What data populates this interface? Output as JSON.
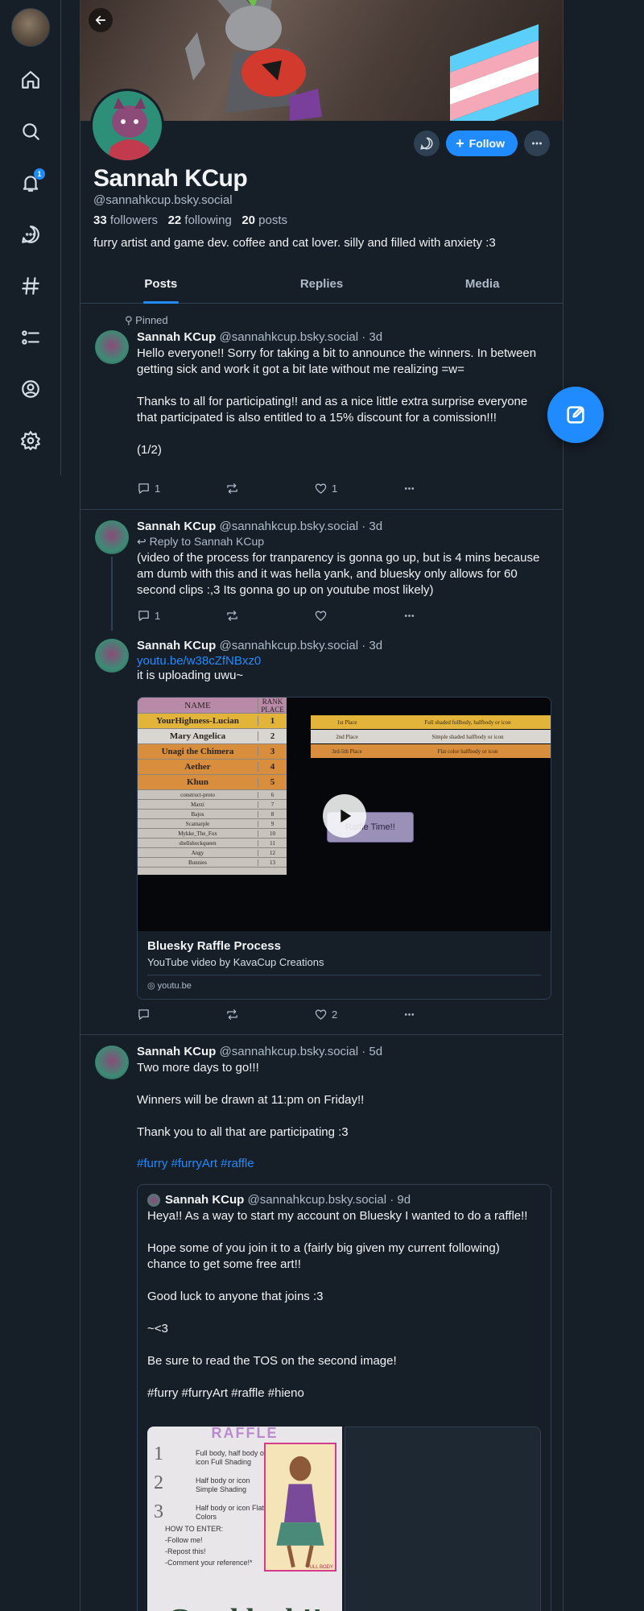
{
  "nav": {
    "notification_count": "1"
  },
  "profile": {
    "display_name": "Sannah KCup",
    "handle": "@sannahkcup.bsky.social",
    "followers_count": "33",
    "followers_label": "followers",
    "following_count": "22",
    "following_label": "following",
    "posts_count": "20",
    "posts_label": "posts",
    "bio": "furry artist and game dev. coffee and cat lover. silly and filled with anxiety :3",
    "follow_label": "Follow"
  },
  "tabs": [
    {
      "label": "Posts"
    },
    {
      "label": "Replies"
    },
    {
      "label": "Media"
    }
  ],
  "posts": [
    {
      "pinned_label": "Pinned",
      "name": "Sannah KCup",
      "handle": "@sannahkcup.bsky.social",
      "time": "· 3d",
      "text": "Hello everyone!! Sorry for taking a bit to announce the winners. In between getting sick and work it got a bit late without me realizing =w=\n\nThanks to all for participating!! and as a nice little extra surprise everyone that participated is also entitled to a 15% discount for a comission!!!\n\n(1/2)",
      "reply_count": "1",
      "repost_count": "",
      "like_count": "1"
    },
    {
      "name": "Sannah KCup",
      "handle": "@sannahkcup.bsky.social",
      "time": "· 3d",
      "reply_to": "Reply to Sannah KCup",
      "text": "(video of the process for tranparency is gonna go up, but is 4 mins because am dumb with this and it was hella yank, and bluesky only allows for 60 second clips :,3 Its gonna go up on youtube most likely)",
      "reply_count": "1",
      "repost_count": "",
      "like_count": ""
    },
    {
      "name": "Sannah KCup",
      "handle": "@sannahkcup.bsky.social",
      "time": "· 3d",
      "link": "youtu.be/w38cZfNBxz0",
      "text": "it is uploading uwu~",
      "embed": {
        "title": "Bluesky Raffle Process",
        "description": "YouTube video by KavaCup Creations",
        "host": "youtu.be",
        "table_header": [
          "NAME",
          "RANK PLACE"
        ],
        "rows": [
          {
            "name": "YourHighness-Lucian",
            "place": "1"
          },
          {
            "name": "Mary Angelica",
            "place": "2"
          },
          {
            "name": "Unagi the Chimera",
            "place": "3"
          },
          {
            "name": "Aether",
            "place": "4"
          },
          {
            "name": "Khun",
            "place": "5"
          },
          {
            "name": "construct-proto",
            "place": "6"
          },
          {
            "name": "Marzi",
            "place": "7"
          },
          {
            "name": "Bajos",
            "place": "8"
          },
          {
            "name": "Scamarple",
            "place": "9"
          },
          {
            "name": "Mykke_The_Fox",
            "place": "10"
          },
          {
            "name": "shellshockqueen",
            "place": "11"
          },
          {
            "name": "Angy",
            "place": "12"
          },
          {
            "name": "Bunnies",
            "place": "13"
          }
        ],
        "prizes": [
          {
            "place": "1st Place",
            "prize": "Full shaded fullbody, halfbody or icon"
          },
          {
            "place": "2nd Place",
            "prize": "Simple shaded halfbody or icon"
          },
          {
            "place": "3rd-5th Place",
            "prize": "Flat color halfbody or icon"
          }
        ],
        "overlay_button": "Raffle Time!!"
      },
      "reply_count": "",
      "repost_count": "",
      "like_count": "2"
    },
    {
      "name": "Sannah KCup",
      "handle": "@sannahkcup.bsky.social",
      "time": "· 5d",
      "text": "Two more days to go!!!\n\nWinners will be drawn at 11:pm on Friday!!\n\nThank you to all that are participating :3",
      "tags": "#furry #furryArt #raffle",
      "quote": {
        "name": "Sannah KCup",
        "handle": "@sannahkcup.bsky.social",
        "time": "· 9d",
        "text": "Heya!! As a way to start my account on Bluesky I wanted to do a raffle!!\n\nHope some of you join it to a (fairly big given my current following) chance to get some free art!!\n\nGood luck to anyone that joins :3\n\n~<3\n\nBe sure to read the TOS on the second image!\n\n#furry #furryArt #raffle #hieno",
        "image": {
          "heading": "RAFFLE",
          "tier1": "Full body, half body or icon Full Shading",
          "tier2": "Half body or icon Simple Shading",
          "tier3": "Half body or icon Flat Colors",
          "how_to": "HOW TO ENTER:\n-Follow me!\n-Repost this!\n-Comment your reference!*",
          "footer": "Good luck!!",
          "corner": "FULL BODY"
        }
      }
    }
  ]
}
